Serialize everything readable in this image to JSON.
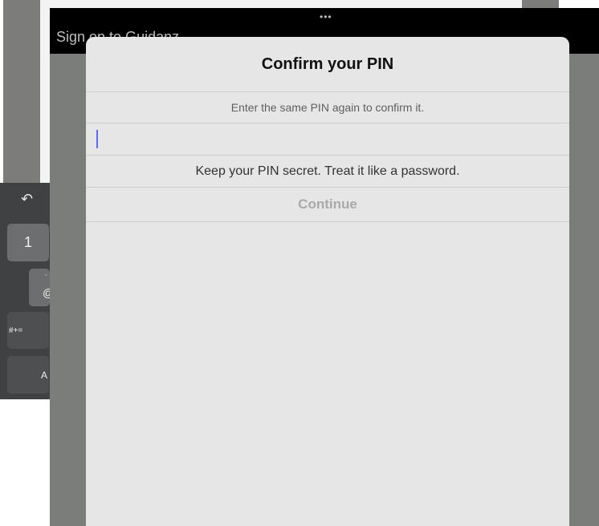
{
  "background": {
    "window_title": "Sign on to Guidanz",
    "keyboard": {
      "undo_icon": "↶",
      "key_1": "1",
      "key_at_sub": "\"",
      "key_at": "@",
      "key_symbols": "#+=",
      "key_a": "A"
    }
  },
  "top_bar": {
    "handle": "•••"
  },
  "dialog": {
    "title": "Confirm your PIN",
    "subtitle": "Enter the same PIN again to confirm it.",
    "pin_value": "",
    "hint": "Keep your PIN secret. Treat it like a password.",
    "continue_label": "Continue"
  },
  "colors": {
    "accent_caret": "#5b6cf0",
    "dialog_bg": "#e6e6e6",
    "disabled_text": "#a9a9a9"
  }
}
